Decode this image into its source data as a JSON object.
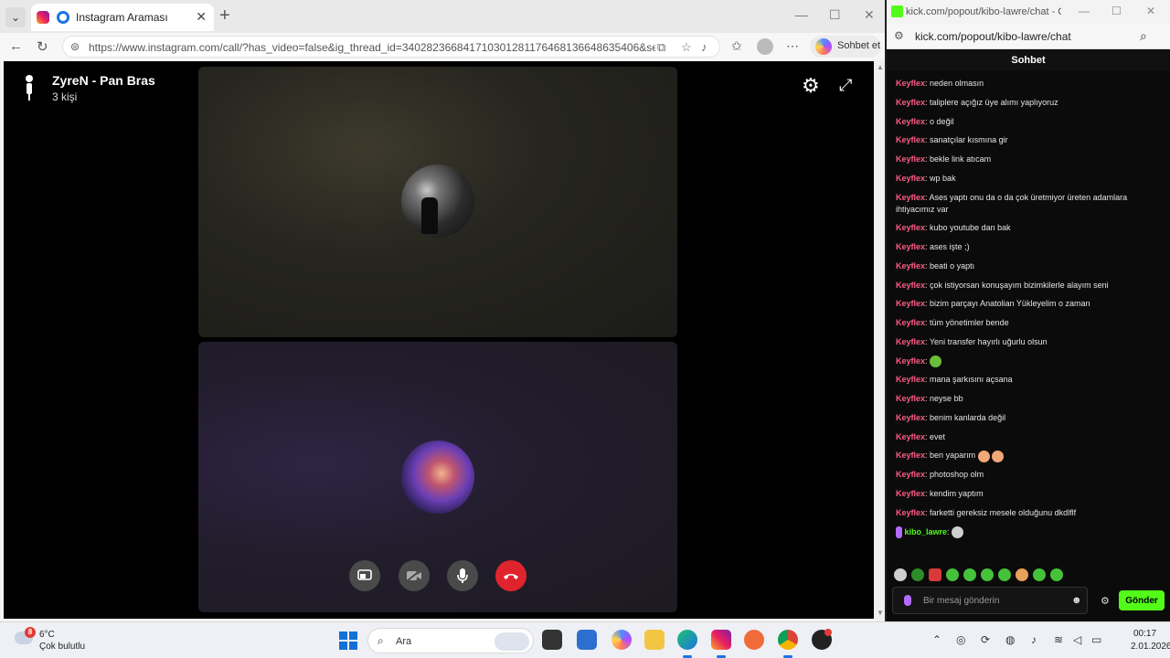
{
  "browser_left": {
    "tab_title": "Instagram Araması",
    "url": "https://www.instagram.com/call/?has_video=false&ig_thread_id=340282366841710301281176468136648635406&ser...",
    "copilot_label": "Sohbet et"
  },
  "call": {
    "name": "ZyreN - Pan Bras",
    "participants": "3 kişi"
  },
  "browser_right": {
    "title": "kick.com/popout/kibo-lawre/chat - G...",
    "url": "kick.com/popout/kibo-lawre/chat"
  },
  "chat": {
    "header": "Sohbet",
    "messages": [
      {
        "user": "Keyflex",
        "text": "neden olmasın"
      },
      {
        "user": "Keyflex",
        "text": "taliplere açığız üye alımı yaplıyoruz"
      },
      {
        "user": "Keyflex",
        "text": "o değil"
      },
      {
        "user": "Keyflex",
        "text": "sanatçılar kısmına gir"
      },
      {
        "user": "Keyflex",
        "text": "bekle link atıcam"
      },
      {
        "user": "Keyflex",
        "text": "wp bak"
      },
      {
        "user": "Keyflex",
        "text": "Ases yaptı onu da o da çok üretmiyor üreten adamlara ihtiyacımız var"
      },
      {
        "user": "Keyflex",
        "text": "kubo youtube dan bak"
      },
      {
        "user": "Keyflex",
        "text": "ases işte ;)"
      },
      {
        "user": "Keyflex",
        "text": "beati o yaptı"
      },
      {
        "user": "Keyflex",
        "text": "çok istiyorsan konuşayım bizimkilerle alayım seni"
      },
      {
        "user": "Keyflex",
        "text": "bizim parçayı Anatolian Yükleyelim o zaman"
      },
      {
        "user": "Keyflex",
        "text": "tüm yönetimler bende"
      },
      {
        "user": "Keyflex",
        "text": "Yeni transfer hayırlı uğurlu olsun"
      },
      {
        "user": "Keyflex",
        "text": ""
      },
      {
        "user": "Keyflex",
        "text": "mana şarkısını açsana"
      },
      {
        "user": "Keyflex",
        "text": "neyse bb"
      },
      {
        "user": "Keyflex",
        "text": "benim kanlarda değil"
      },
      {
        "user": "Keyflex",
        "text": "evet"
      },
      {
        "user": "Keyflex",
        "text": "ben yaparım"
      },
      {
        "user": "Keyflex",
        "text": "photoshop olm"
      },
      {
        "user": "Keyflex",
        "text": "kendim yaptım"
      },
      {
        "user": "Keyflex",
        "text": "farketti gereksiz mesele olduğunu dkdlflf"
      },
      {
        "user": "kibo_lawre",
        "text": ""
      }
    ],
    "input_placeholder": "Bir mesaj gönderin",
    "send_label": "Gönder"
  },
  "taskbar": {
    "temp": "6°C",
    "condition": "Çok bulutlu",
    "weather_badge": "8",
    "search_placeholder": "Ara",
    "time": "00:17",
    "date": "2.01.2026"
  }
}
